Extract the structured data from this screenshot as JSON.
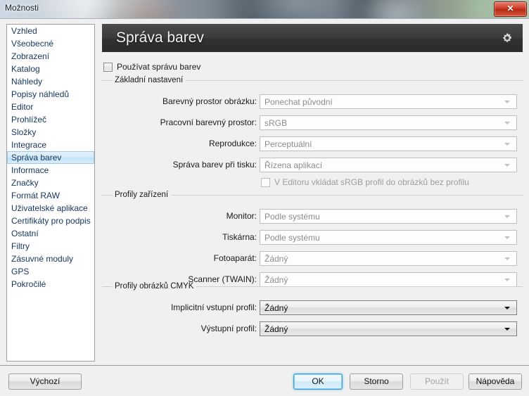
{
  "window": {
    "title": "Možnosti",
    "close_label": "✕"
  },
  "sidebar": {
    "items": [
      {
        "label": "Vzhled",
        "selected": false
      },
      {
        "label": "Všeobecné",
        "selected": false
      },
      {
        "label": "Zobrazení",
        "selected": false
      },
      {
        "label": "Katalog",
        "selected": false
      },
      {
        "label": "Náhledy",
        "selected": false
      },
      {
        "label": "Popisy náhledů",
        "selected": false
      },
      {
        "label": "Editor",
        "selected": false
      },
      {
        "label": "Prohlížeč",
        "selected": false
      },
      {
        "label": "Složky",
        "selected": false
      },
      {
        "label": "Integrace",
        "selected": false
      },
      {
        "label": "Správa barev",
        "selected": true
      },
      {
        "label": "Informace",
        "selected": false
      },
      {
        "label": "Značky",
        "selected": false
      },
      {
        "label": "Formát RAW",
        "selected": false
      },
      {
        "label": "Uživatelské aplikace",
        "selected": false
      },
      {
        "label": "Certifikáty pro podpis",
        "selected": false
      },
      {
        "label": "Ostatní",
        "selected": false
      },
      {
        "label": "Filtry",
        "selected": false
      },
      {
        "label": "Zásuvné moduly",
        "selected": false
      },
      {
        "label": "GPS",
        "selected": false
      },
      {
        "label": "Pokročilé",
        "selected": false
      }
    ]
  },
  "panel": {
    "header_title": "Správa barev",
    "gear_icon": "gear-icon",
    "enable_checkbox": {
      "label": "Používat správu barev",
      "checked": false
    },
    "groups": [
      {
        "title": "Základní nastavení",
        "rows": [
          {
            "label": "Barevný prostor obrázku:",
            "value": "Ponechat původní",
            "enabled": false
          },
          {
            "label": "Pracovní barevný prostor:",
            "value": "sRGB",
            "enabled": false
          },
          {
            "label": "Reprodukce:",
            "value": "Perceptuální",
            "enabled": false
          },
          {
            "label": "Správa barev při tisku:",
            "value": "Řízena aplikací",
            "enabled": false
          }
        ],
        "checkbox": {
          "label": "V Editoru vkládat sRGB profil do obrázků bez profilu",
          "checked": false,
          "enabled": false
        }
      },
      {
        "title": "Profily zařízení",
        "rows": [
          {
            "label": "Monitor:",
            "value": "Podle systému",
            "enabled": false
          },
          {
            "label": "Tiskárna:",
            "value": "Podle systému",
            "enabled": false
          },
          {
            "label": "Fotoaparát:",
            "value": "Žádný",
            "enabled": false
          },
          {
            "label": "Scanner (TWAIN):",
            "value": "Žádný",
            "enabled": false
          }
        ]
      },
      {
        "title": "Profily obrázků CMYK",
        "rows": [
          {
            "label": "Implicitní vstupní profil:",
            "value": "Žádný",
            "enabled": true
          },
          {
            "label": "Výstupní profil:",
            "value": "Žádný",
            "enabled": true
          }
        ]
      }
    ]
  },
  "footer": {
    "buttons": [
      {
        "label": "Výchozí",
        "state": "normal"
      },
      {
        "label": "OK",
        "state": "default"
      },
      {
        "label": "Storno",
        "state": "normal"
      },
      {
        "label": "Použít",
        "state": "disabled"
      },
      {
        "label": "Nápověda",
        "state": "normal"
      }
    ]
  },
  "colors": {
    "header_dark": "#3b3b3b",
    "selection_blue": "#c3e2f7",
    "default_button_focus": "#3c9fd4",
    "close_red": "#cf3b24",
    "sidebar_text": "#16365e"
  }
}
